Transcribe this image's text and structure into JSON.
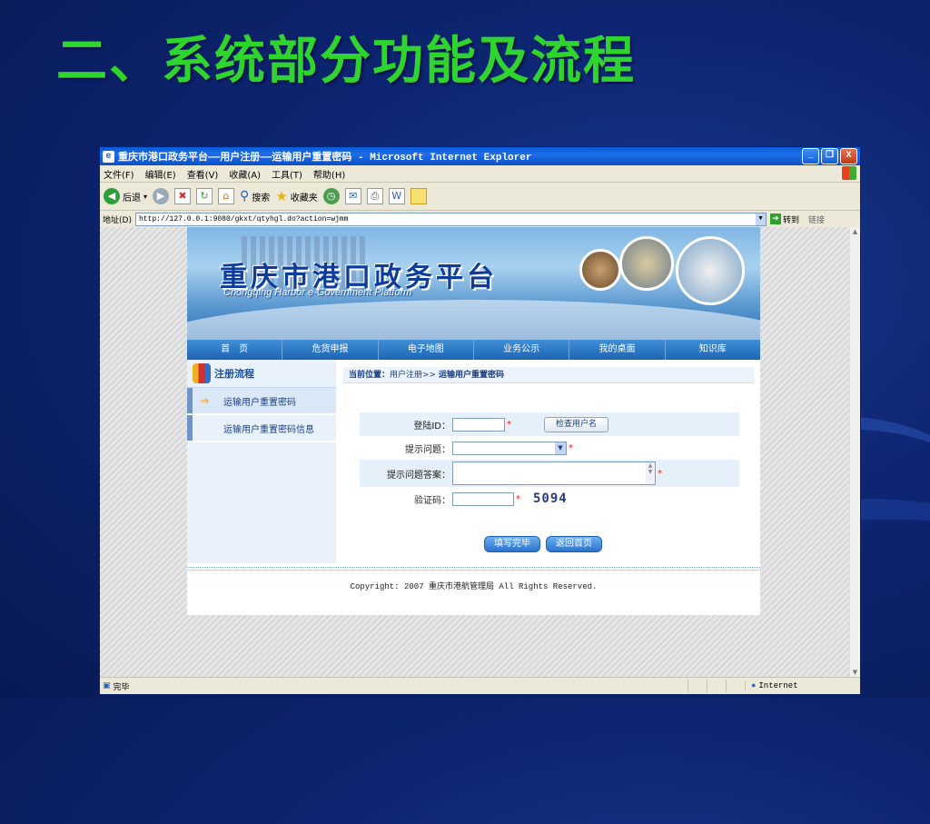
{
  "slide": {
    "title": "二、系统部分功能及流程"
  },
  "window": {
    "title": "重庆市港口政务平台——用户注册——运输用户重置密码 - Microsoft Internet Explorer",
    "minimize": "_",
    "restore": "❐",
    "close": "X"
  },
  "menu": [
    "文件(F)",
    "编辑(E)",
    "查看(V)",
    "收藏(A)",
    "工具(T)",
    "帮助(H)"
  ],
  "toolbar": {
    "back": "后退",
    "search": "搜索",
    "favorites": "收藏夹"
  },
  "address": {
    "label": "地址(D)",
    "url": "http://127.0.0.1:9080/gkxt/qtyhgl.do?action=wjmm",
    "go": "转到",
    "links": "链接"
  },
  "banner": {
    "title": "重庆市港口政务平台",
    "subtitle": "Chongqing Harbor e-Government Platform"
  },
  "nav": [
    "首　页",
    "危货申报",
    "电子地图",
    "业务公示",
    "我的桌面",
    "知识库"
  ],
  "sidebar": {
    "heading": "注册流程",
    "items": [
      {
        "label": "运输用户重置密码",
        "active": true
      },
      {
        "label": "运输用户重置密码信息",
        "active": false
      }
    ]
  },
  "breadcrumb": {
    "prefix": "当前位置：",
    "path": "用户注册>>",
    "current": "运输用户重置密码"
  },
  "form": {
    "login_label": "登陆ID：",
    "check_button": "检查用户名",
    "question_label": "提示问题：",
    "answer_label": "提示问题答案：",
    "captcha_label": "验证码：",
    "captcha_value": "5094",
    "required_mark": "*"
  },
  "actions": {
    "submit": "填写完毕",
    "back_home": "返回首页"
  },
  "footer": {
    "copyright": "Copyright: 2007 重庆市港航管理局 All Rights Reserved."
  },
  "status": {
    "text": "完毕",
    "zone": "Internet"
  },
  "colors": {
    "slide_title": "#2fd42f",
    "slide_bg": "#0d2470",
    "nav": "#1e64b4",
    "banner_title": "#0d3d9c"
  }
}
